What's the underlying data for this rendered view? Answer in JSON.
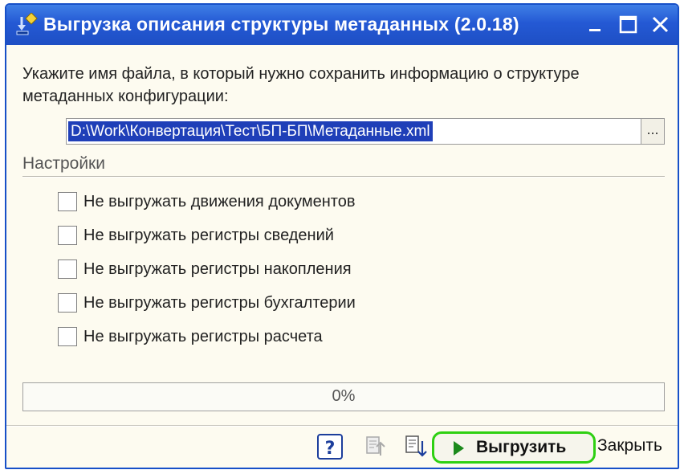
{
  "window": {
    "title": "Выгрузка описания структуры метаданных (2.0.18)"
  },
  "prompt": {
    "text": "Укажите имя файла, в который нужно сохранить информацию о структуре метаданных конфигурации:"
  },
  "file": {
    "path": "D:\\Work\\Конвертация\\Тест\\БП-БП\\Метаданные.xml",
    "browse_label": "..."
  },
  "settings": {
    "label": "Настройки",
    "options": [
      {
        "label": "Не выгружать движения документов",
        "checked": false
      },
      {
        "label": "Не выгружать регистры сведений",
        "checked": false
      },
      {
        "label": "Не выгружать регистры накопления",
        "checked": false
      },
      {
        "label": "Не выгружать регистры бухгалтерии",
        "checked": false
      },
      {
        "label": "Не выгружать регистры расчета",
        "checked": false
      }
    ]
  },
  "progress": {
    "value": 0,
    "text": "0%"
  },
  "footer": {
    "run_label": "Выгрузить",
    "close_label": "Закрыть"
  },
  "colors": {
    "titlebar": "#2459d4",
    "highlight": "#2ed012",
    "selection": "#1f3fb8"
  }
}
